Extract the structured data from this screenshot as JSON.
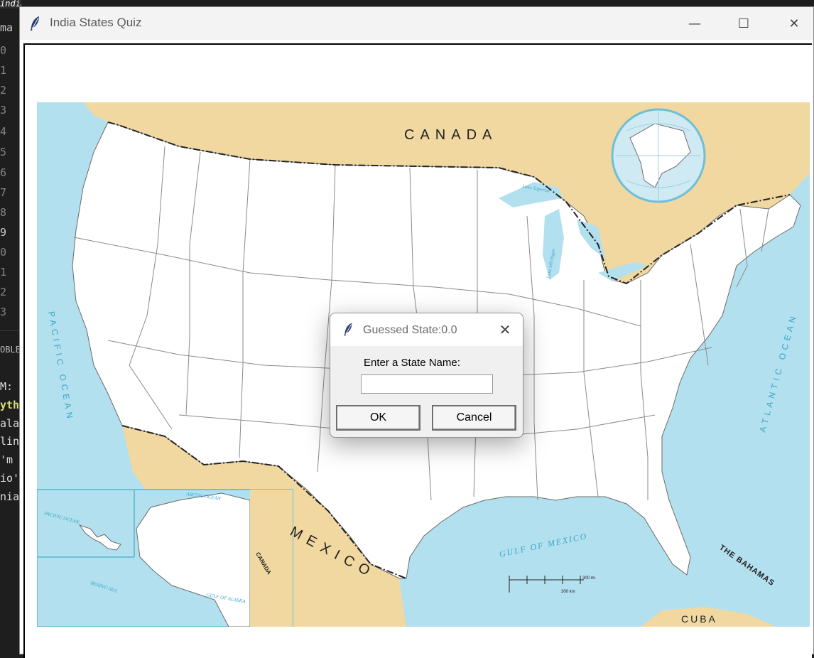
{
  "editor": {
    "tab_label": "india.py",
    "gutter": [
      "ma",
      "0",
      "1",
      "2",
      "3",
      "4",
      "5",
      "6",
      "7",
      "8",
      "9",
      "0",
      "1",
      "2",
      "3"
    ],
    "panel_label": "OBLE",
    "code": [
      "M:",
      "yth",
      "ala",
      "lin",
      " 'm",
      "io'",
      "nia"
    ]
  },
  "window": {
    "title": "India States Quiz",
    "controls": {
      "minimize": "—",
      "maximize": "☐",
      "close": "✕"
    }
  },
  "map": {
    "labels": {
      "canada": "CANADA",
      "mexico": "MEXICO",
      "pacific_ocean": "PACIFIC OCEAN",
      "atlantic_ocean": "ATLANTIC OCEAN",
      "gulf_of_mexico": "GULF OF MEXICO",
      "the_bahamas": "THE BAHAMAS",
      "cuba": "CUBA",
      "lake_superior": "Lake Superior",
      "lake_michigan": "Lake Michigan",
      "arctic_ocean": "ARCTIC OCEAN",
      "bering_sea": "BERING SEA",
      "gulf_of_alaska": "GULF OF ALASKA",
      "inset_pacific_ocean": "PACIFIC OCEAN",
      "inset_canada": "CANADA",
      "scale_mi": "300 mi",
      "scale_km": "300 km"
    },
    "colors": {
      "water": "#b3e0ee",
      "foreign_land": "#f0d8a0",
      "us_land": "#ffffff",
      "state_border": "#8a8a8a"
    }
  },
  "dialog": {
    "title": "Guessed State:0.0",
    "prompt": "Enter a State Name:",
    "input_value": "",
    "ok_label": "OK",
    "cancel_label": "Cancel",
    "close": "✕"
  }
}
